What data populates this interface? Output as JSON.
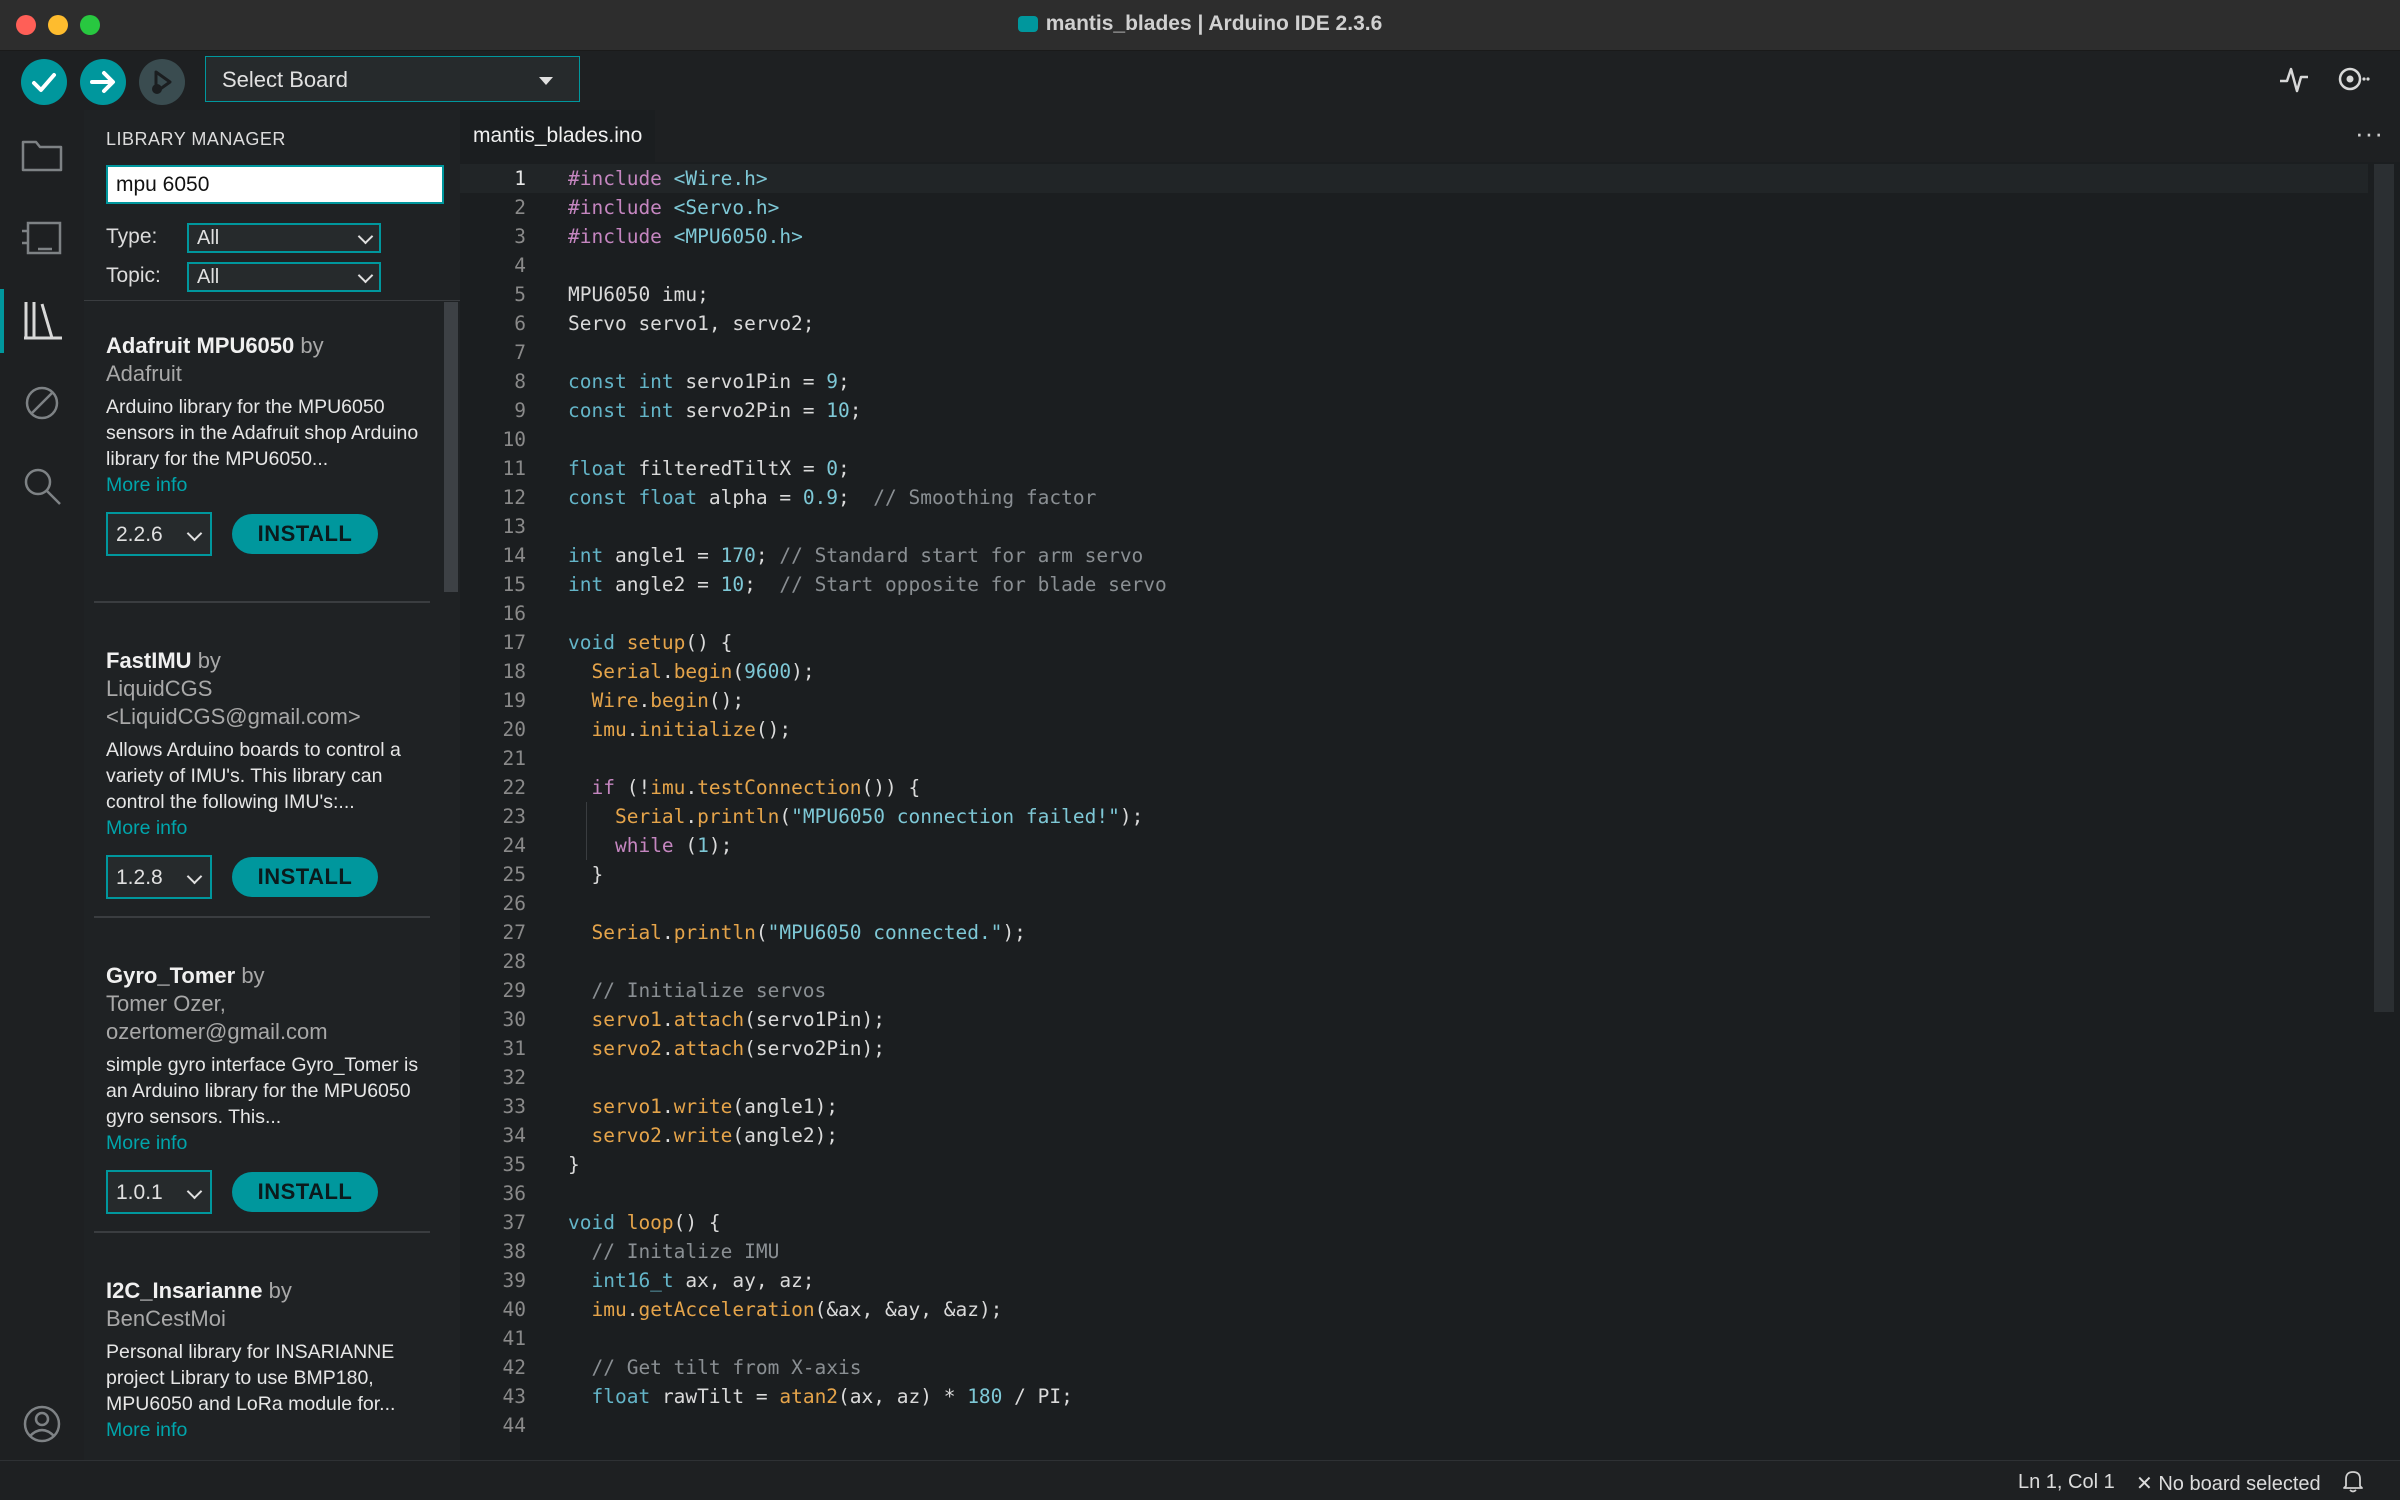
{
  "window": {
    "title": "mantis_blades | Arduino IDE 2.3.6"
  },
  "toolbar": {
    "board_select": "Select Board"
  },
  "library_manager": {
    "title": "LIBRARY MANAGER",
    "search_value": "mpu 6050",
    "type_label": "Type:",
    "type_value": "All",
    "topic_label": "Topic:",
    "topic_value": "All",
    "libraries": [
      {
        "name": "Adafruit MPU6050",
        "by": "by",
        "author": "Adafruit",
        "desc": "Arduino library for the MPU6050 sensors in the Adafruit shop Arduino library for the MPU6050...",
        "more": "More info",
        "version": "2.2.6",
        "install": "INSTALL"
      },
      {
        "name": "FastIMU",
        "by": "by",
        "author": "LiquidCGS <LiquidCGS@gmail.com>",
        "desc": "Allows Arduino boards to control a variety of IMU's. This library can control the following IMU's:...",
        "more": "More info",
        "version": "1.2.8",
        "install": "INSTALL"
      },
      {
        "name": "Gyro_Tomer",
        "by": "by",
        "author": "Tomer Ozer, ozertomer@gmail.com",
        "desc": "simple gyro interface Gyro_Tomer is an Arduino library for the MPU6050 gyro sensors. This...",
        "more": "More info",
        "version": "1.0.1",
        "install": "INSTALL"
      },
      {
        "name": "I2C_Insarianne",
        "by": "by",
        "author": "BenCestMoi",
        "desc": "Personal library for INSARIANNE project Library to use BMP180, MPU6050 and LoRa module for...",
        "more": "More info"
      }
    ]
  },
  "editor": {
    "tab": "mantis_blades.ino",
    "code": [
      [
        [
          "#include ",
          "k1"
        ],
        [
          "<Wire.h>",
          "str"
        ]
      ],
      [
        [
          "#include ",
          "k1"
        ],
        [
          "<Servo.h>",
          "str"
        ]
      ],
      [
        [
          "#include ",
          "k1"
        ],
        [
          "<MPU6050.h>",
          "str"
        ]
      ],
      [],
      [
        [
          "MPU6050 imu;",
          ""
        ]
      ],
      [
        [
          "Servo servo1, servo2;",
          ""
        ]
      ],
      [],
      [
        [
          "const int ",
          "k2"
        ],
        [
          "servo1Pin = ",
          ""
        ],
        [
          "9",
          "num"
        ],
        [
          ";",
          ""
        ]
      ],
      [
        [
          "const int ",
          "k2"
        ],
        [
          "servo2Pin = ",
          ""
        ],
        [
          "10",
          "num"
        ],
        [
          ";",
          ""
        ]
      ],
      [],
      [
        [
          "float ",
          "k2"
        ],
        [
          "filteredTiltX = ",
          ""
        ],
        [
          "0",
          "num"
        ],
        [
          ";",
          ""
        ]
      ],
      [
        [
          "const float ",
          "k2"
        ],
        [
          "alpha = ",
          ""
        ],
        [
          "0.9",
          "num"
        ],
        [
          ";  ",
          ""
        ],
        [
          "// Smoothing factor",
          "cm"
        ]
      ],
      [],
      [
        [
          "int ",
          "k2"
        ],
        [
          "angle1 = ",
          ""
        ],
        [
          "170",
          "num"
        ],
        [
          "; ",
          ""
        ],
        [
          "// Standard start for arm servo",
          "cm"
        ]
      ],
      [
        [
          "int ",
          "k2"
        ],
        [
          "angle2 = ",
          ""
        ],
        [
          "10",
          "num"
        ],
        [
          ";  ",
          ""
        ],
        [
          "// Start opposite for blade servo",
          "cm"
        ]
      ],
      [],
      [
        [
          "void ",
          "k2"
        ],
        [
          "setup",
          "fn"
        ],
        [
          "() {",
          ""
        ]
      ],
      [
        [
          "  ",
          ""
        ],
        [
          "Serial",
          "fn"
        ],
        [
          ".",
          ""
        ],
        [
          "begin",
          "fn"
        ],
        [
          "(",
          ""
        ],
        [
          "9600",
          "num"
        ],
        [
          ");",
          ""
        ]
      ],
      [
        [
          "  ",
          ""
        ],
        [
          "Wire",
          "fn"
        ],
        [
          ".",
          ""
        ],
        [
          "begin",
          "fn"
        ],
        [
          "();",
          ""
        ]
      ],
      [
        [
          "  ",
          ""
        ],
        [
          "imu",
          "fn"
        ],
        [
          ".",
          ""
        ],
        [
          "initialize",
          "fn"
        ],
        [
          "();",
          ""
        ]
      ],
      [],
      [
        [
          "  ",
          ""
        ],
        [
          "if ",
          "k1"
        ],
        [
          "(!",
          ""
        ],
        [
          "imu",
          "fn"
        ],
        [
          ".",
          ""
        ],
        [
          "testConnection",
          "fn"
        ],
        [
          "()) {",
          ""
        ]
      ],
      [
        [
          "    ",
          ""
        ],
        [
          "Serial",
          "fn"
        ],
        [
          ".",
          ""
        ],
        [
          "println",
          "fn"
        ],
        [
          "(",
          ""
        ],
        [
          "\"MPU6050 connection failed!\"",
          "str"
        ],
        [
          ");",
          ""
        ]
      ],
      [
        [
          "    ",
          ""
        ],
        [
          "while ",
          "k1"
        ],
        [
          "(",
          ""
        ],
        [
          "1",
          "num"
        ],
        [
          ");",
          ""
        ]
      ],
      [
        [
          "  }",
          ""
        ]
      ],
      [],
      [
        [
          "  ",
          ""
        ],
        [
          "Serial",
          "fn"
        ],
        [
          ".",
          ""
        ],
        [
          "println",
          "fn"
        ],
        [
          "(",
          ""
        ],
        [
          "\"MPU6050 connected.\"",
          "str"
        ],
        [
          ");",
          ""
        ]
      ],
      [],
      [
        [
          "  ",
          ""
        ],
        [
          "// Initialize servos",
          "cm"
        ]
      ],
      [
        [
          "  ",
          ""
        ],
        [
          "servo1",
          "fn"
        ],
        [
          ".",
          ""
        ],
        [
          "attach",
          "fn"
        ],
        [
          "(servo1Pin);",
          ""
        ]
      ],
      [
        [
          "  ",
          ""
        ],
        [
          "servo2",
          "fn"
        ],
        [
          ".",
          ""
        ],
        [
          "attach",
          "fn"
        ],
        [
          "(servo2Pin);",
          ""
        ]
      ],
      [],
      [
        [
          "  ",
          ""
        ],
        [
          "servo1",
          "fn"
        ],
        [
          ".",
          ""
        ],
        [
          "write",
          "fn"
        ],
        [
          "(angle1);",
          ""
        ]
      ],
      [
        [
          "  ",
          ""
        ],
        [
          "servo2",
          "fn"
        ],
        [
          ".",
          ""
        ],
        [
          "write",
          "fn"
        ],
        [
          "(angle2);",
          ""
        ]
      ],
      [
        [
          "}",
          ""
        ]
      ],
      [],
      [
        [
          "void ",
          "k2"
        ],
        [
          "loop",
          "fn"
        ],
        [
          "() {",
          ""
        ]
      ],
      [
        [
          "  ",
          ""
        ],
        [
          "// Initalize IMU",
          "cm"
        ]
      ],
      [
        [
          "  ",
          ""
        ],
        [
          "int16_t ",
          "k2"
        ],
        [
          "ax, ay, az;",
          ""
        ]
      ],
      [
        [
          "  ",
          ""
        ],
        [
          "imu",
          "fn"
        ],
        [
          ".",
          ""
        ],
        [
          "getAcceleration",
          "fn"
        ],
        [
          "(&ax, &ay, &az);",
          ""
        ]
      ],
      [],
      [
        [
          "  ",
          ""
        ],
        [
          "// Get tilt from X-axis",
          "cm"
        ]
      ],
      [
        [
          "  ",
          ""
        ],
        [
          "float ",
          "k2"
        ],
        [
          "rawTilt = ",
          ""
        ],
        [
          "atan2",
          "fn"
        ],
        [
          "(ax, az) * ",
          ""
        ],
        [
          "180",
          "num"
        ],
        [
          " / PI;",
          ""
        ]
      ],
      []
    ]
  },
  "status": {
    "position": "Ln 1, Col 1",
    "board": "No board selected"
  },
  "colors": {
    "accent": "#00979d",
    "background": "#1e2022"
  }
}
